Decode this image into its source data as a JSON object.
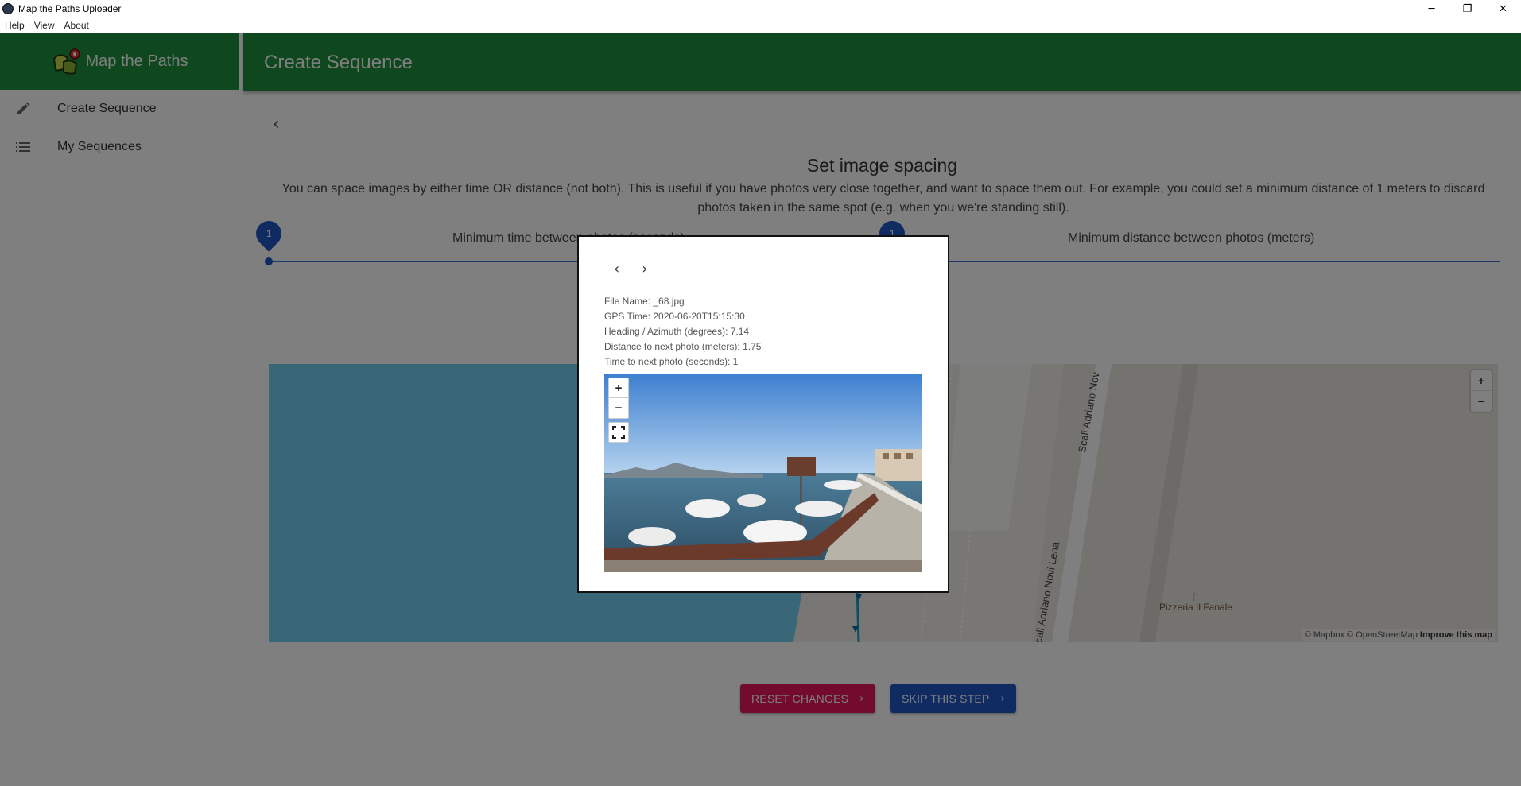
{
  "window": {
    "title": "Map the Paths Uploader",
    "controls": {
      "minimize": "─",
      "restore": "❐",
      "close": "✕"
    }
  },
  "menu": [
    "Help",
    "View",
    "About"
  ],
  "sidebar": {
    "brand": "Map the Paths",
    "items": [
      {
        "label": "Create Sequence",
        "icon": "pencil-icon"
      },
      {
        "label": "My Sequences",
        "icon": "list-icon"
      }
    ]
  },
  "header": {
    "title": "Create Sequence"
  },
  "step": {
    "title": "Set image spacing",
    "description": "You can space images by either time OR distance (not both). This is useful if you have photos very close together, and want to space them out. For example, you could set a minimum distance of 1 meters to discard photos taken in the same spot (e.g. when you we're standing still).",
    "time_slider": {
      "label": "Minimum time between photos (seconds)",
      "value": "1"
    },
    "distance_slider": {
      "label": "Minimum distance between photos (meters)",
      "value": "1"
    }
  },
  "map": {
    "zoom_in": "+",
    "zoom_out": "−",
    "streets": [
      "Scali Adriano Nov",
      "cali Adriano Novi Lena"
    ],
    "poi": "Pizzeria Il Fanale",
    "poi_icon": "fork-knife-icon",
    "attribution": "© Mapbox © OpenStreetMap",
    "improve": "Improve this map"
  },
  "buttons": {
    "reset": "RESET CHANGES",
    "skip": "SKIP THIS STEP",
    "reset_color": "#e6175c",
    "skip_color": "#1f57c3"
  },
  "modal": {
    "prev": "‹",
    "next": "›",
    "info": [
      "File Name: _68.jpg",
      "GPS Time: 2020-06-20T15:15:30",
      "Heading / Azimuth (degrees): 7.14",
      "Distance to next photo (meters): 1.75",
      "Time to next photo (seconds): 1"
    ],
    "zoom_in": "+",
    "zoom_out": "−"
  },
  "colors": {
    "brand_green": "#1e8e3e",
    "accent_blue": "#1f57c3"
  }
}
